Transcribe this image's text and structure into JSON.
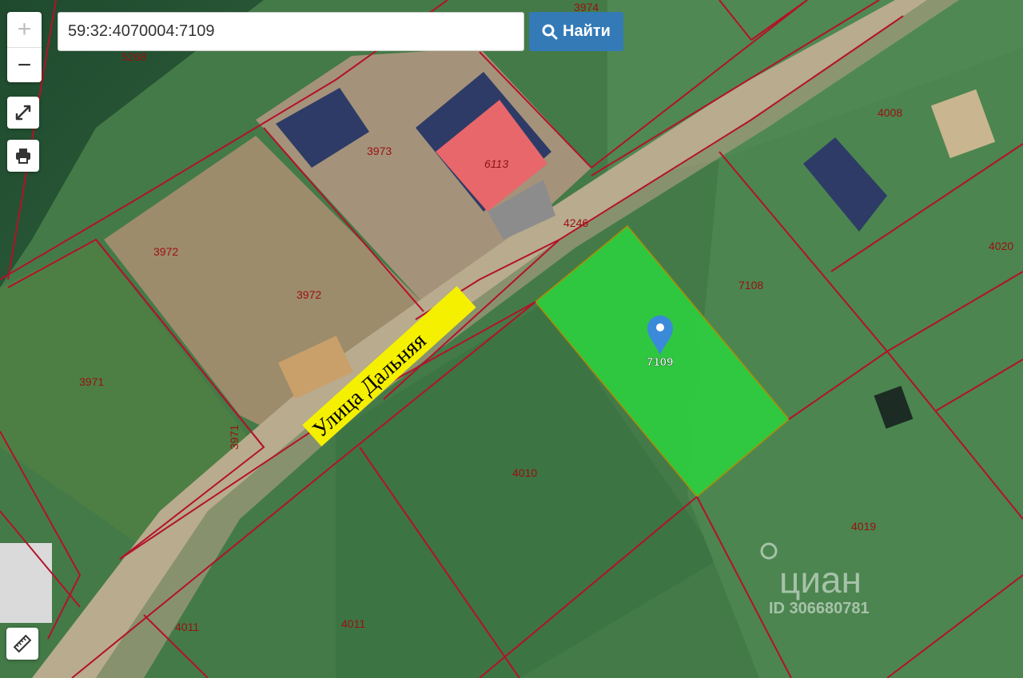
{
  "search": {
    "value": "59:32:4070004:7109",
    "button_label": "Найти"
  },
  "controls": {
    "zoom_in": "+",
    "zoom_out": "−"
  },
  "street": {
    "name": "Улица Дальняя"
  },
  "selected_parcel": {
    "label": "7109",
    "color": "#2ecc40"
  },
  "building_label": "6113",
  "parcel_labels": {
    "p3974": "3974",
    "p5268": "5268",
    "p3973": "3973",
    "p4246": "4246",
    "p4008": "4008",
    "p4020": "4020",
    "p3972a": "3972",
    "p3972b": "3972",
    "p7108": "7108",
    "p3971a": "3971",
    "p3971b": "3971",
    "p4010": "4010",
    "p4019": "4019",
    "p4011a": "4011",
    "p4011b": "4011"
  },
  "watermark": {
    "brand": "циан",
    "id": "ID 306680781"
  },
  "colors": {
    "boundary": "#b3122a",
    "accent": "#337ab7",
    "street_label_bg": "#f5f000",
    "roof_red": "#e8676a",
    "roof_blue": "#2e3b66"
  }
}
